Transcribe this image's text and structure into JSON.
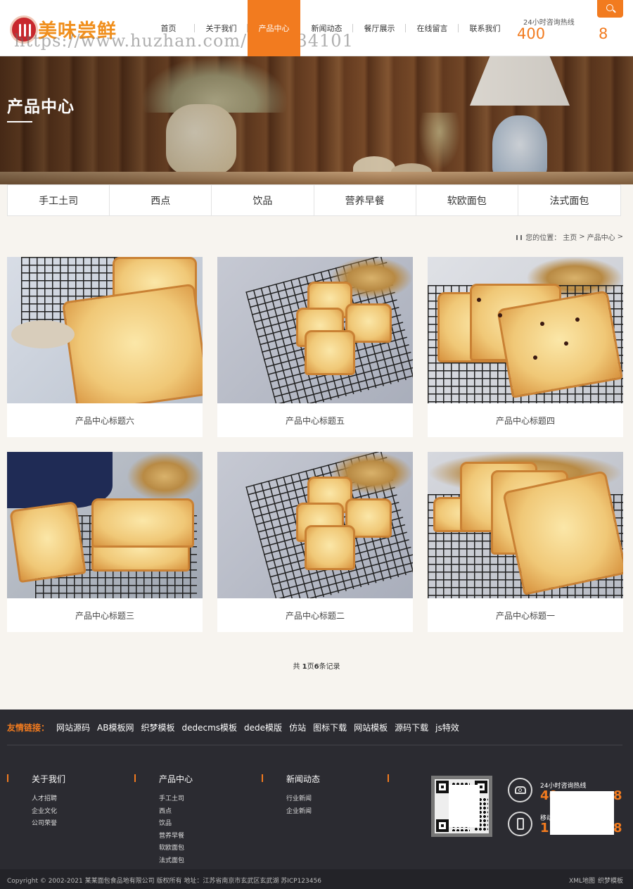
{
  "header": {
    "logo_text": "美味尝鲜",
    "watermark": "https://www.huzhan.com/ishop34101",
    "nav": [
      {
        "label": "首页"
      },
      {
        "label": "关于我们"
      },
      {
        "label": "产品中心",
        "active": true
      },
      {
        "label": "新闻动态"
      },
      {
        "label": "餐厅展示"
      },
      {
        "label": "在线留言"
      },
      {
        "label": "联系我们"
      }
    ],
    "hotline_label": "24小时咨询热线",
    "hotline_a": "400",
    "hotline_b": "8",
    "search_icon": "search-icon"
  },
  "banner": {
    "title": "产品中心"
  },
  "categories": [
    "手工土司",
    "西点",
    "饮品",
    "营养早餐",
    "软欧面包",
    "法式面包"
  ],
  "breadcrumb": {
    "prefix": "您的位置：",
    "home": "主页",
    "sep": ">",
    "current": "产品中心",
    "trail": ">"
  },
  "products": [
    {
      "title": "产品中心标题六"
    },
    {
      "title": "产品中心标题五"
    },
    {
      "title": "产品中心标题四"
    },
    {
      "title": "产品中心标题三"
    },
    {
      "title": "产品中心标题二"
    },
    {
      "title": "产品中心标题一"
    }
  ],
  "pagination": {
    "pre": "共 ",
    "pages": "1",
    "mid": "页",
    "records": "6",
    "post": "条记录"
  },
  "footer": {
    "links_label": "友情链接：",
    "links": [
      "网站源码",
      "AB模板网",
      "织梦模板",
      "dedecms模板",
      "dede模版",
      "仿站",
      "图标下载",
      "网站模板",
      "源码下载",
      "js特效"
    ],
    "columns": [
      {
        "title": "关于我们",
        "items": [
          "人才招聘",
          "企业文化",
          "公司荣誉"
        ]
      },
      {
        "title": "产品中心",
        "items": [
          "手工土司",
          "西点",
          "饮品",
          "营养早餐",
          "软欧面包",
          "法式面包"
        ]
      },
      {
        "title": "新闻动态",
        "items": [
          "行业新闻",
          "企业新闻"
        ]
      }
    ],
    "contact": {
      "hotline_label": "24小时咨询热线",
      "hotline_num_a": "40",
      "hotline_num_b": "8",
      "mobile_label": "移动",
      "mobile_num_a": "1",
      "mobile_num_b": "8"
    },
    "copyright": "Copyright © 2002-2021 某某面包食品地有限公司 版权所有   地址：江苏省南京市玄武区玄武湖   苏ICP123456",
    "bottom_links": [
      "XML地图",
      "织梦模板"
    ]
  },
  "colors": {
    "accent": "#f27b1f",
    "footer_bg": "#2b2b31",
    "page_bg": "#f7f4ef"
  }
}
